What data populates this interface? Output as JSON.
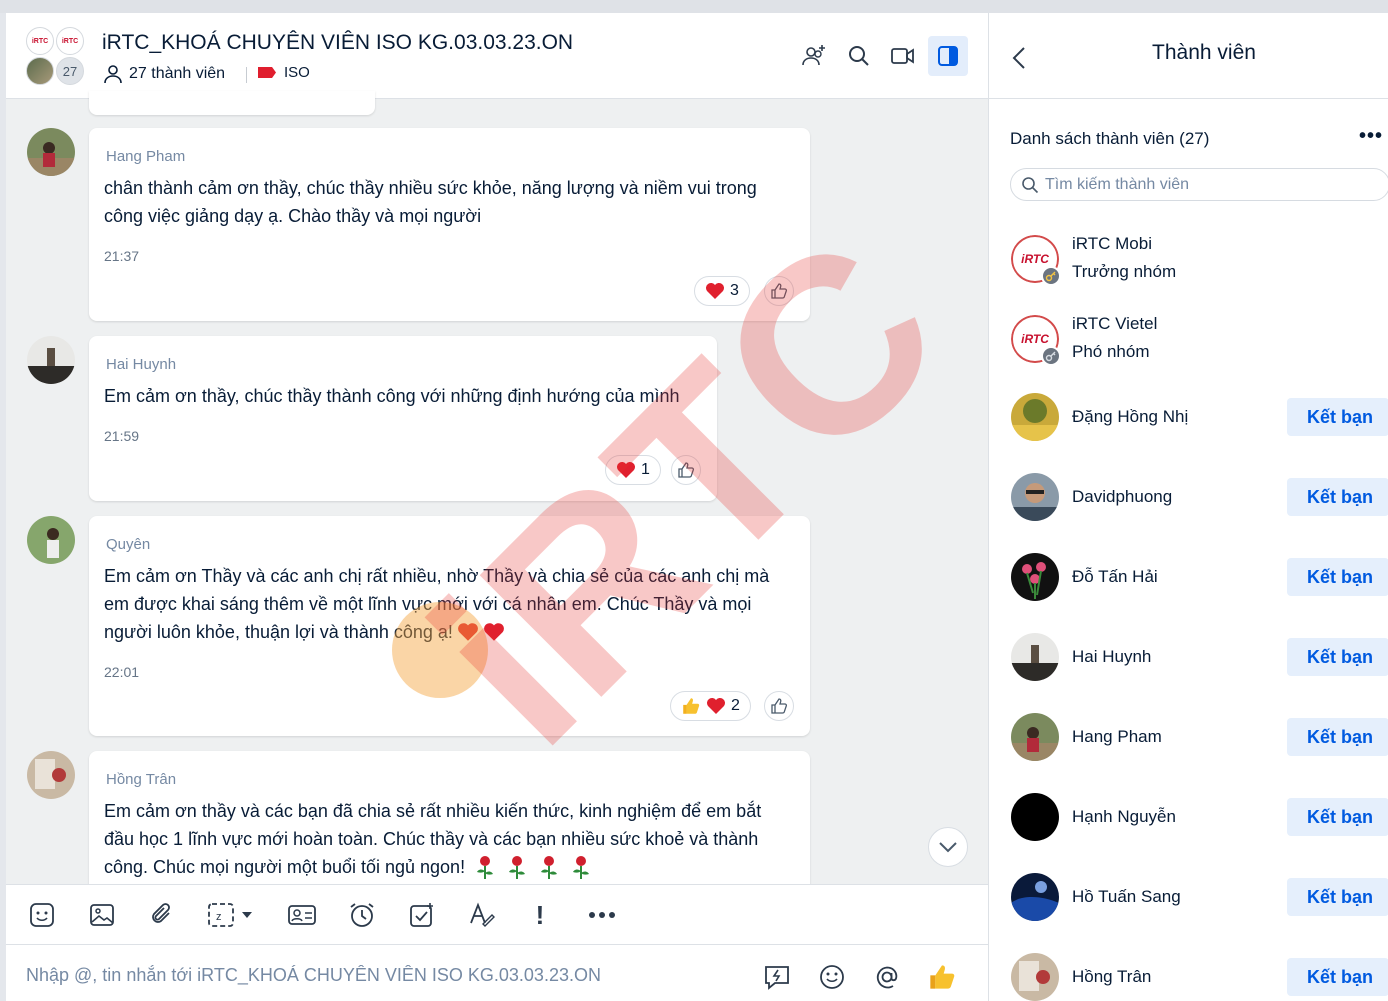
{
  "chat": {
    "title": "iRTC_KHOÁ CHUYÊN VIÊN ISO KG.03.03.23.ON",
    "member_count_label": "27 thành viên",
    "tag_label": "ISO",
    "avatar_count": "27",
    "logo_text": "iRTC"
  },
  "messages": [
    {
      "sender": "Hang Pham",
      "lines": [
        "chân thành cảm ơn thầy, chúc thầy nhiều sức khỏe, năng lượng và niềm vui trong",
        "công việc giảng dạy ạ. Chào thầy và mọi người"
      ],
      "time": "21:37",
      "reaction_count": "3"
    },
    {
      "sender": "Hai Huynh",
      "lines": [
        "Em cảm ơn thầy, chúc thầy thành công với những định hướng của mình"
      ],
      "time": "21:59",
      "reaction_count": "1"
    },
    {
      "sender": "Quyên",
      "lines": [
        "Em cảm ơn Thầy và các anh chị rất nhiều, nhờ Thầy và chia sẻ của các anh chị mà",
        "em được khai sáng thêm về một lĩnh vực mới với cá nhân em. Chúc Thầy và mọi",
        "người luôn khỏe, thuận lợi và thành công ạ!"
      ],
      "time": "22:01",
      "reaction_count": "2"
    },
    {
      "sender": "Hồng Trân",
      "lines": [
        "Em cảm ơn thầy và các bạn đã chia sẻ rất nhiều kiến thức, kinh nghiệm để em bắt",
        "đầu học 1 lĩnh vực mới hoàn toàn. Chúc thầy và các bạn nhiều sức khoẻ và thành",
        "công. Chúc mọi người một buổi tối ngủ ngon!"
      ]
    }
  ],
  "composer": {
    "placeholder": "Nhập @, tin nhắn tới iRTC_KHOÁ CHUYÊN VIÊN ISO KG.03.03.23.ON"
  },
  "panel": {
    "title": "Thành viên",
    "list_title": "Danh sách thành viên (27)",
    "search_placeholder": "Tìm kiếm thành viên",
    "add_friend_label": "Kết bạn",
    "members": [
      {
        "name": "iRTC Mobi",
        "role": "Trưởng nhóm"
      },
      {
        "name": "iRTC Vietel",
        "role": "Phó nhóm"
      },
      {
        "name": "Đặng Hồng Nhị"
      },
      {
        "name": "Davidphuong"
      },
      {
        "name": "Đỗ Tấn Hải"
      },
      {
        "name": "Hai Huynh"
      },
      {
        "name": "Hang Pham"
      },
      {
        "name": "Hạnh Nguyễn"
      },
      {
        "name": "Hồ Tuấn Sang"
      },
      {
        "name": "Hồng Trân"
      }
    ]
  },
  "watermark_text": "iRTC",
  "colors": {
    "accent": "#005ae0",
    "watermark": "#e8302b",
    "heart": "#e0202e"
  }
}
